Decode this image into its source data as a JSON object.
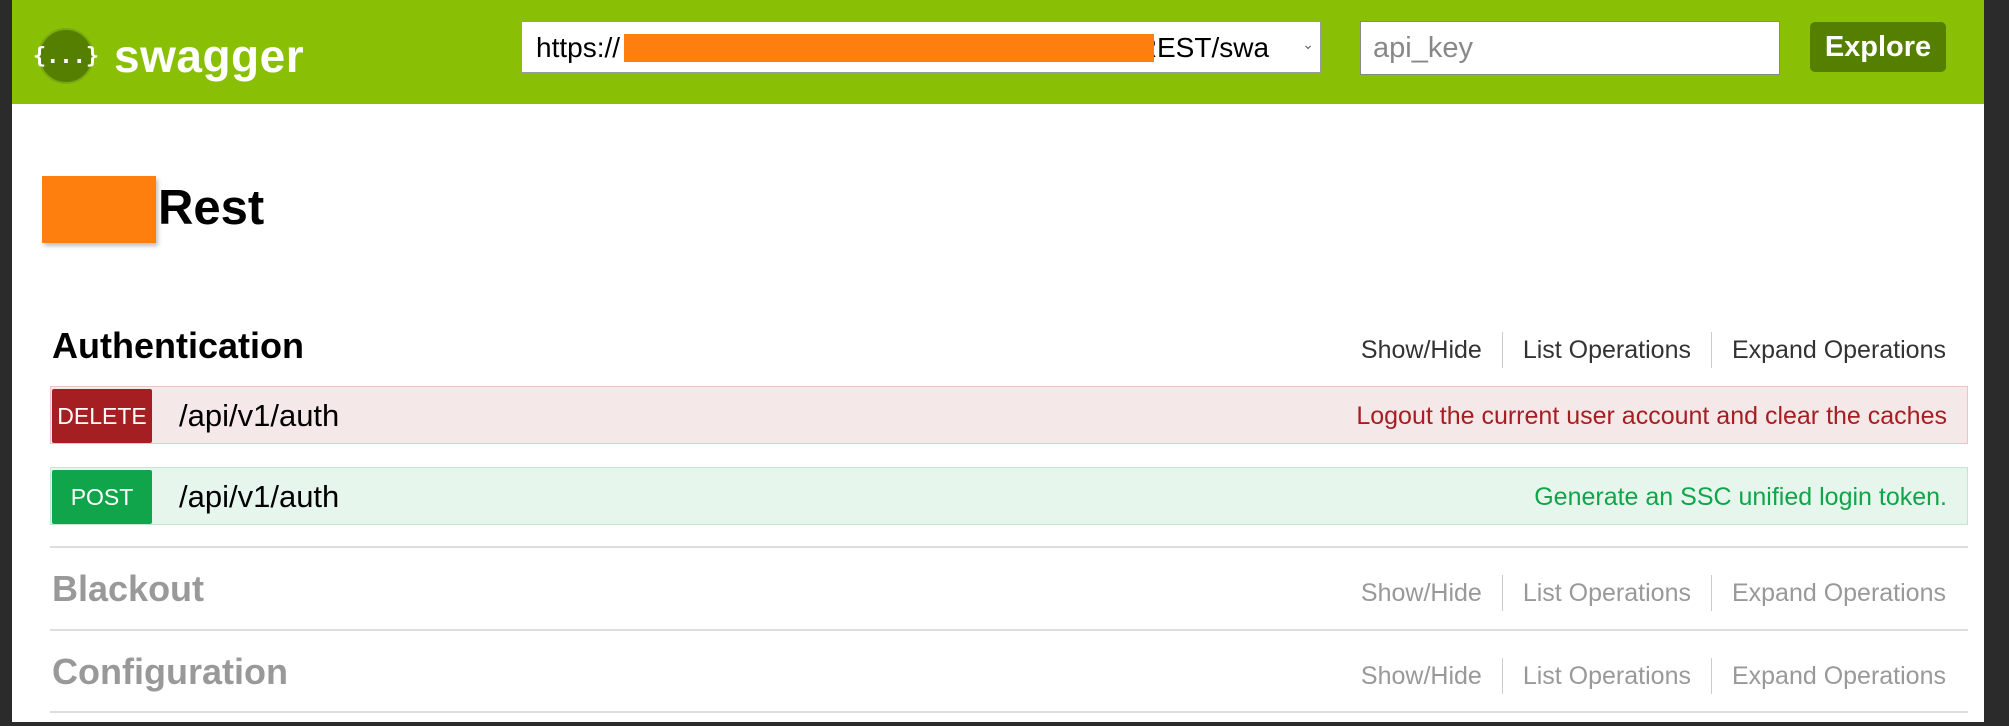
{
  "header": {
    "logo_glyph": "{...}",
    "logo_text": "swagger",
    "url_prefix": "https://",
    "url_suffix": "/REST/swa",
    "api_key_placeholder": "api_key",
    "explore_label": "Explore",
    "brand_color": "#89bf04",
    "button_color": "#547f00"
  },
  "title": "Rest",
  "links": {
    "show_hide": "Show/Hide",
    "list_operations": "List Operations",
    "expand_operations": "Expand Operations"
  },
  "resources": [
    {
      "name": "Authentication",
      "operations": [
        {
          "method": "DELETE",
          "path": "/api/v1/auth",
          "summary": "Logout the current user account and clear the caches",
          "color": "#a41e22"
        },
        {
          "method": "POST",
          "path": "/api/v1/auth",
          "summary": "Generate an SSC unified login token.",
          "color": "#10a54a"
        }
      ]
    },
    {
      "name": "Blackout"
    },
    {
      "name": "Configuration"
    }
  ]
}
